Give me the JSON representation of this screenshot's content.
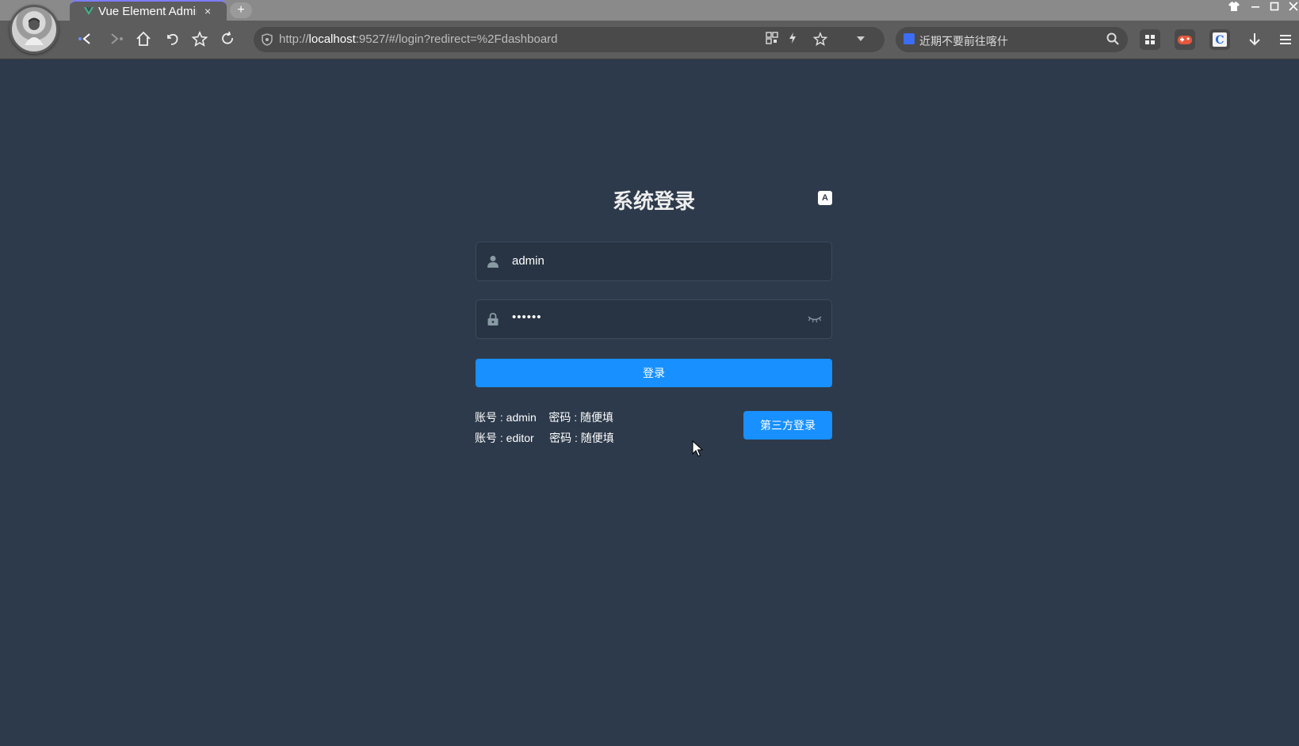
{
  "browser": {
    "tab_title": "Vue Element Admin",
    "tab_close": "×",
    "new_tab": "+",
    "url_prefix": "http://",
    "url_host": "localhost",
    "url_rest": ":9527/#/login?redirect=%2Fdashboard",
    "search_text": "近期不要前往喀什"
  },
  "login": {
    "title": "系统登录",
    "lang_icon_label": "A",
    "username_value": "admin",
    "password_value": "••••••",
    "login_button": "登录",
    "tip1": "账号 : admin    密码 : 随便填",
    "tip2": "账号 : editor     密码 : 随便填",
    "third_party_button": "第三方登录"
  }
}
